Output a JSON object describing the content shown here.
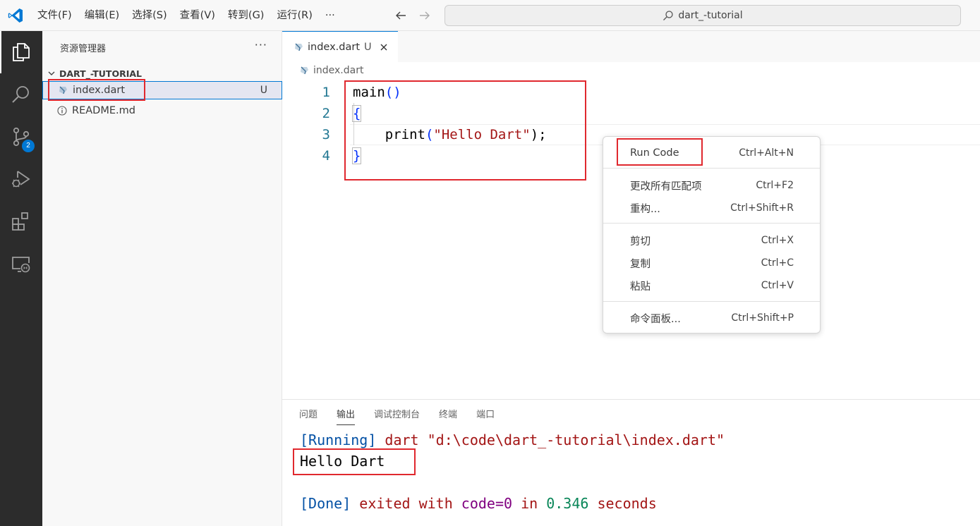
{
  "titlebar": {
    "menu": [
      "文件(F)",
      "编辑(E)",
      "选择(S)",
      "查看(V)",
      "转到(G)",
      "运行(R)",
      "···"
    ],
    "search_text": "dart_-tutorial"
  },
  "activitybar": {
    "icons": [
      "explorer-icon",
      "search-icon",
      "source-control-icon",
      "run-debug-icon",
      "extensions-icon",
      "remote-explorer-icon"
    ],
    "source_control_badge": "2"
  },
  "sidebar": {
    "title": "资源管理器",
    "more": "···",
    "section": "DART_-TUTORIAL",
    "files": [
      {
        "name": "index.dart",
        "status": "U",
        "icon": "dart-file-icon"
      },
      {
        "name": "README.md",
        "status": "",
        "icon": "info-icon"
      }
    ]
  },
  "editor": {
    "tab": {
      "name": "index.dart",
      "status": "U"
    },
    "breadcrumb": "index.dart",
    "lines": [
      {
        "no": "1",
        "tokens": [
          {
            "t": "main",
            "c": "tok-fn"
          },
          {
            "t": "()",
            "c": "tok-paren"
          }
        ]
      },
      {
        "no": "2",
        "tokens": [
          {
            "t": "{",
            "c": "tok-brace bracket-box"
          }
        ]
      },
      {
        "no": "3",
        "tokens": [
          {
            "t": "    print",
            "c": "tok-plain"
          },
          {
            "t": "(",
            "c": "tok-paren"
          },
          {
            "t": "\"Hello Dart\"",
            "c": "tok-str"
          },
          {
            "t": ");",
            "c": "tok-plain"
          }
        ]
      },
      {
        "no": "4",
        "tokens": [
          {
            "t": "}",
            "c": "tok-brace bracket-box"
          }
        ]
      }
    ]
  },
  "context_menu": {
    "items": [
      {
        "label": "Run Code",
        "shortcut": "Ctrl+Alt+N"
      },
      {
        "label": "更改所有匹配项",
        "shortcut": "Ctrl+F2"
      },
      {
        "label": "重构...",
        "shortcut": "Ctrl+Shift+R"
      },
      {
        "label": "剪切",
        "shortcut": "Ctrl+X"
      },
      {
        "label": "复制",
        "shortcut": "Ctrl+C"
      },
      {
        "label": "粘贴",
        "shortcut": "Ctrl+V"
      },
      {
        "label": "命令面板...",
        "shortcut": "Ctrl+Shift+P"
      }
    ]
  },
  "panel": {
    "tabs": [
      "问题",
      "输出",
      "调试控制台",
      "终端",
      "端口"
    ],
    "active_tab": "输出",
    "output": {
      "line1": [
        {
          "t": "[Running]",
          "c": "o-blue"
        },
        {
          "t": " dart \"d:\\code\\dart_-tutorial\\index.dart\"",
          "c": "o-red"
        }
      ],
      "line2": [
        {
          "t": "Hello Dart",
          "c": "o-black"
        }
      ],
      "line3": [
        {
          "t": "[Done]",
          "c": "o-blue"
        },
        {
          "t": " exited with ",
          "c": "o-red"
        },
        {
          "t": "code=0",
          "c": "o-purple"
        },
        {
          "t": " in ",
          "c": "o-red"
        },
        {
          "t": "0.346",
          "c": "o-green"
        },
        {
          "t": " seconds",
          "c": "o-red"
        }
      ]
    }
  },
  "colors": {
    "accent": "#0078d4",
    "annotation": "#e0282e"
  }
}
